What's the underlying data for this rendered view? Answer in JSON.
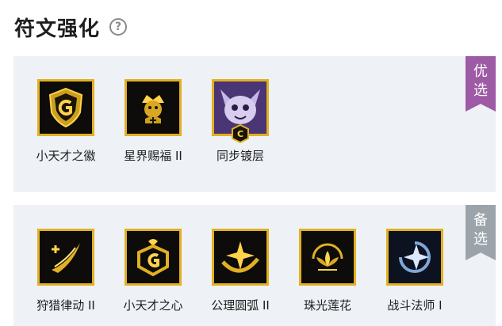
{
  "header": {
    "title": "符文强化",
    "help_icon": "question-circle-icon"
  },
  "sections": [
    {
      "tag": [
        "优",
        "选"
      ],
      "tag_color": "#9d5aa5",
      "items": [
        {
          "label": "小天才之徽",
          "icon": "shield-g-icon"
        },
        {
          "label": "星界赐福 II",
          "icon": "astral-blessing-icon"
        },
        {
          "label": "同步镀层",
          "icon": "yordle-portrait-icon",
          "badge": "C"
        }
      ]
    },
    {
      "tag": [
        "备",
        "选"
      ],
      "tag_color": "#9ca4ab",
      "items": [
        {
          "label": "狩猎律动 II",
          "icon": "hunting-rhythm-icon"
        },
        {
          "label": "小天才之心",
          "icon": "genius-heart-icon"
        },
        {
          "label": "公理圆弧 II",
          "icon": "axiom-arc-icon"
        },
        {
          "label": "珠光莲花",
          "icon": "pearl-lotus-icon"
        },
        {
          "label": "战斗法师 I",
          "icon": "battle-mage-icon"
        }
      ]
    }
  ],
  "colors": {
    "accent_gold": "#e2b021",
    "panel_bg": "#eef1f6"
  }
}
